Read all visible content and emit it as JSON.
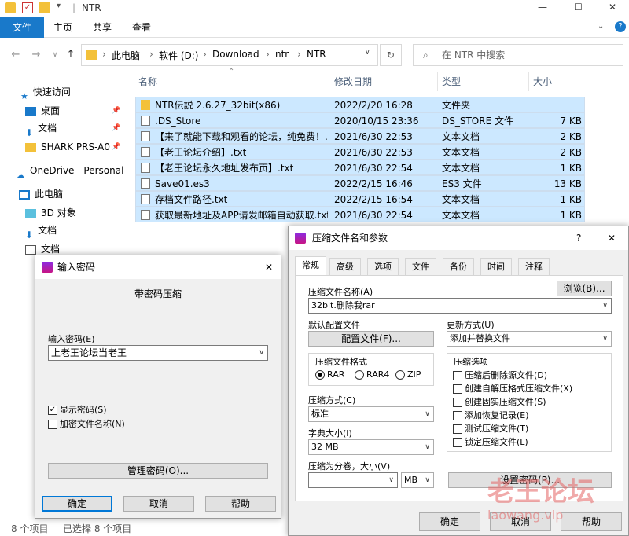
{
  "window": {
    "title": "NTR",
    "min": "—",
    "max": "☐",
    "close": "✕"
  },
  "ribbon": {
    "file": "文件",
    "tabs": [
      "主页",
      "共享",
      "查看"
    ],
    "help": "?"
  },
  "address": {
    "crumbs": [
      "此电脑",
      "软件 (D:)",
      "Download",
      "ntr",
      "NTR"
    ],
    "search_placeholder": "在 NTR 中搜索"
  },
  "sidebar": {
    "items": [
      {
        "label": "快速访问",
        "icon": "star-icon"
      },
      {
        "label": "桌面",
        "icon": "desktop-icon"
      },
      {
        "label": "文档",
        "icon": "download-icon"
      },
      {
        "label": "SHARK PRS-A0",
        "icon": "folder-icon"
      },
      {
        "label": "OneDrive - Personal",
        "icon": "cloud-icon"
      },
      {
        "label": "此电脑",
        "icon": "computer-icon"
      },
      {
        "label": "3D 对象",
        "icon": "cube-icon"
      },
      {
        "label": "文档",
        "icon": "download-icon"
      },
      {
        "label": "文档",
        "icon": "document-icon"
      }
    ]
  },
  "columns": {
    "name": "名称",
    "date": "修改日期",
    "type": "类型",
    "size": "大小"
  },
  "files": [
    {
      "name": "NTR伝説 2.6.27_32bit(x86)",
      "date": "2022/2/20 16:28",
      "type": "文件夹",
      "size": "",
      "icon": "folder-icon"
    },
    {
      "name": ".DS_Store",
      "date": "2020/10/15 23:36",
      "type": "DS_STORE 文件",
      "size": "7 KB",
      "icon": "file-icon"
    },
    {
      "name": "【来了就能下载和观看的论坛，纯免费！...",
      "date": "2021/6/30 22:53",
      "type": "文本文档",
      "size": "2 KB",
      "icon": "text-file-icon"
    },
    {
      "name": "【老王论坛介绍】.txt",
      "date": "2021/6/30 22:53",
      "type": "文本文档",
      "size": "2 KB",
      "icon": "text-file-icon"
    },
    {
      "name": "【老王论坛永久地址发布页】.txt",
      "date": "2021/6/30 22:54",
      "type": "文本文档",
      "size": "1 KB",
      "icon": "text-file-icon"
    },
    {
      "name": "Save01.es3",
      "date": "2022/2/15 16:46",
      "type": "ES3 文件",
      "size": "13 KB",
      "icon": "file-icon"
    },
    {
      "name": "存档文件路径.txt",
      "date": "2022/2/15 16:54",
      "type": "文本文档",
      "size": "1 KB",
      "icon": "text-file-icon"
    },
    {
      "name": "获取最新地址及APP请发邮箱自动获取.txt",
      "date": "2021/6/30 22:54",
      "type": "文本文档",
      "size": "1 KB",
      "icon": "text-file-icon"
    }
  ],
  "status": {
    "count": "8 个项目",
    "selected": "已选择 8 个项目"
  },
  "pwd_dialog": {
    "title": "输入密码",
    "close": "✕",
    "heading": "带密码压缩",
    "label": "输入密码(E)",
    "value": "上老王论坛当老王",
    "show_pwd": "显示密码(S)",
    "encrypt_names": "加密文件名称(N)",
    "manage": "管理密码(O)...",
    "ok": "确定",
    "cancel": "取消",
    "help": "帮助"
  },
  "archive_dialog": {
    "title": "压缩文件名和参数",
    "help": "?",
    "close": "✕",
    "tabs": [
      "常规",
      "高级",
      "选项",
      "文件",
      "备份",
      "时间",
      "注释"
    ],
    "name_label": "压缩文件名称(A)",
    "browse": "浏览(B)...",
    "name_value": "32bit.删除我rar",
    "profile_label": "默认配置文件",
    "profile_btn": "配置文件(F)...",
    "update_label": "更新方式(U)",
    "update_value": "添加并替换文件",
    "format_label": "压缩文件格式",
    "formats": [
      "RAR",
      "RAR4",
      "ZIP"
    ],
    "method_label": "压缩方式(C)",
    "method_value": "标准",
    "dict_label": "字典大小(I)",
    "dict_value": "32 MB",
    "split_label": "压缩为分卷，大小(V)",
    "split_unit": "MB",
    "options_label": "压缩选项",
    "options": [
      "压缩后删除源文件(D)",
      "创建自解压格式压缩文件(X)",
      "创建固实压缩文件(S)",
      "添加恢复记录(E)",
      "测试压缩文件(T)",
      "锁定压缩文件(L)"
    ],
    "set_pwd": "设置密码(P)...",
    "ok": "确定",
    "cancel": "取消",
    "help_btn": "帮助"
  },
  "watermark": {
    "text": "老王论坛",
    "url": "laowang.vip"
  }
}
